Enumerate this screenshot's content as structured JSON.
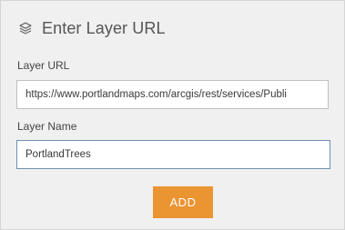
{
  "header": {
    "icon": "layers-icon",
    "title": "Enter Layer URL"
  },
  "form": {
    "layer_url_label": "Layer URL",
    "layer_url_value": "https://www.portlandmaps.com/arcgis/rest/services/Publi",
    "layer_name_label": "Layer Name",
    "layer_name_value": "PortlandTrees",
    "add_label": "ADD"
  },
  "colors": {
    "panel_background": "#f0f0f0",
    "button_accent": "#ea9432",
    "focused_input_border": "#6f8fb4"
  }
}
